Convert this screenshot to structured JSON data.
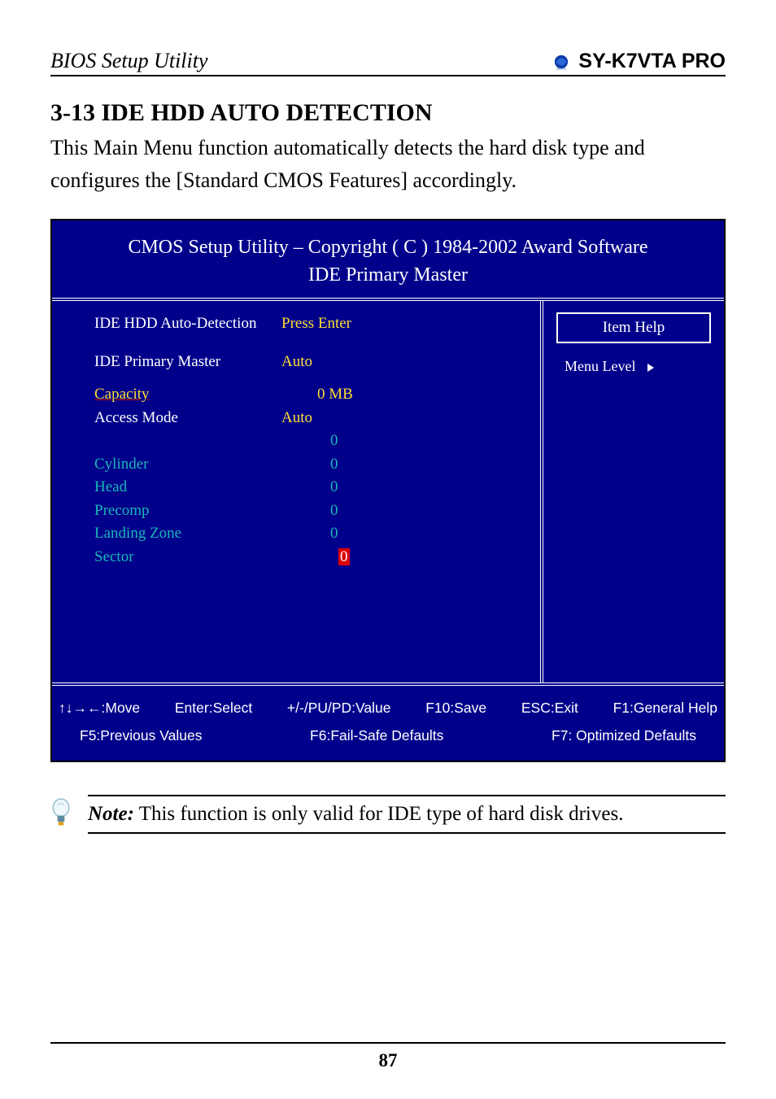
{
  "header": {
    "left": "BIOS Setup Utility",
    "right": "SY-K7VTA PRO"
  },
  "section": {
    "heading": "3-13  IDE HDD AUTO DETECTION",
    "body": "This Main Menu function automatically detects the hard disk type and configures the [Standard CMOS Features] accordingly."
  },
  "bios": {
    "title_line1": "CMOS Setup Utility – Copyright ( C ) 1984-2002 Award Software",
    "title_line2": "IDE Primary Master",
    "rows": {
      "auto_detect_label": "IDE HDD Auto-Detection",
      "auto_detect_value": "Press Enter",
      "primary_master_label": "IDE Primary Master",
      "primary_master_value": "Auto",
      "capacity_label": "Capacity",
      "capacity_value": "0 MB",
      "access_mode_label": "Access Mode",
      "access_mode_value": "Auto",
      "access_mode_sub": "0",
      "cylinder_label": "Cylinder",
      "cylinder_value": "0",
      "head_label": "Head",
      "head_value": "0",
      "precomp_label": "Precomp",
      "precomp_value": "0",
      "landing_label": "Landing Zone",
      "landing_value": "0",
      "sector_label": "Sector",
      "sector_value": "0"
    },
    "help": {
      "item_help": "Item Help",
      "menu_level": "Menu Level"
    },
    "footer": {
      "move": "↑↓→←:Move",
      "enter": "Enter:Select",
      "pupd": "+/-/PU/PD:Value",
      "f10": "F10:Save",
      "esc": "ESC:Exit",
      "f1": "F1:General Help",
      "f5": "F5:Previous Values",
      "f6": "F6:Fail-Safe Defaults",
      "f7": "F7: Optimized Defaults"
    }
  },
  "note": {
    "label": "Note:",
    "text": " This function is only valid for IDE type of hard disk drives."
  },
  "page_number": "87"
}
